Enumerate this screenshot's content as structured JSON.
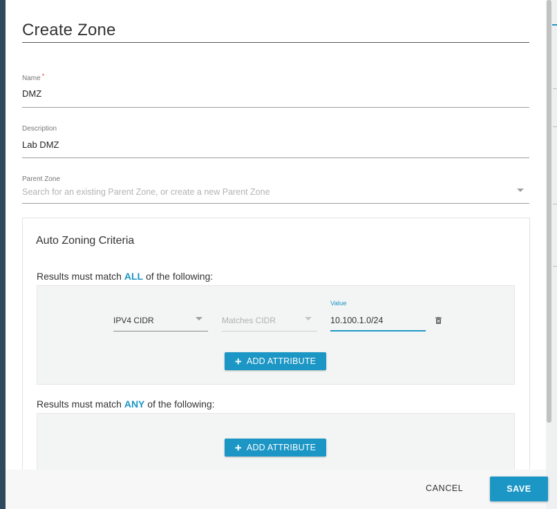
{
  "dialog": {
    "title": "Create Zone"
  },
  "form": {
    "name": {
      "label": "Name",
      "required_mark": "*",
      "value": "DMZ"
    },
    "description": {
      "label": "Description",
      "value": "Lab DMZ"
    },
    "parent_zone": {
      "label": "Parent Zone",
      "placeholder": "Search for an existing Parent Zone, or create a new Parent Zone"
    }
  },
  "auto_zoning": {
    "title": "Auto Zoning Criteria",
    "all_group": {
      "prefix": "Results must match",
      "keyword": "ALL",
      "suffix": "of the following:",
      "rule": {
        "attribute": "IPV4 CIDR",
        "operator": "Matches CIDR",
        "value_label": "Value",
        "value": "10.100.1.0/24"
      },
      "add_label": "ADD ATTRIBUTE"
    },
    "any_group": {
      "prefix": "Results must match",
      "keyword": "ANY",
      "suffix": "of the following:",
      "add_label": "ADD ATTRIBUTE"
    }
  },
  "footer": {
    "cancel_label": "CANCEL",
    "save_label": "SAVE"
  },
  "colors": {
    "accent": "#1c96c5",
    "sidebar": "#2e4a5c",
    "required": "#e53935"
  },
  "icons": {
    "add": "plus-icon",
    "delete": "trash-icon",
    "dropdown": "caret-down-icon"
  }
}
